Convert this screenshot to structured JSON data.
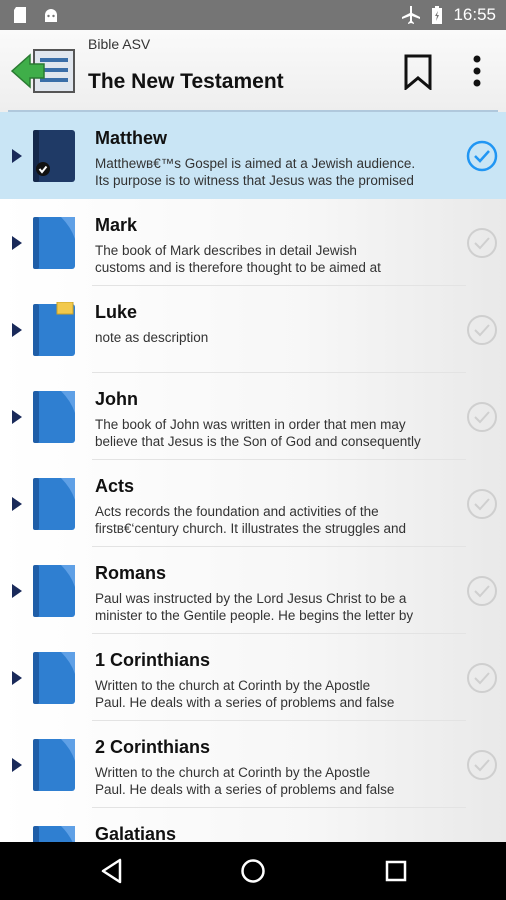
{
  "status": {
    "time": "16:55"
  },
  "header": {
    "subtitle": "Bible ASV",
    "title": "The New Testament"
  },
  "icons": {
    "back": "back-arrow-list-icon",
    "bookmark": "bookmark-icon",
    "menu": "more-vert-icon",
    "book": "book-icon",
    "check": "check-circle-icon"
  },
  "colors": {
    "selected_row": "#c9e5f5",
    "accent": "#2196f3",
    "book_blue": "#2f7fd1",
    "book_dark": "#1f3a66"
  },
  "books": [
    {
      "name": "Matthew",
      "line1": "Matthewв€™s Gospel is aimed at a Jewish audience.",
      "line2": "Its purpose is to witness that Jesus was the promised"
    },
    {
      "name": "Mark",
      "line1": "The book of Mark describes in detail Jewish",
      "line2": "customs and is therefore thought to be aimed at"
    },
    {
      "name": "Luke",
      "line1": "note as description",
      "line2": ""
    },
    {
      "name": "John",
      "line1": "The book of John was written in order that men may",
      "line2": "believe that Jesus is the Son of God and consequently"
    },
    {
      "name": "Acts",
      "line1": "Acts records the foundation and activities of the",
      "line2": "firstв€‘century church. It illustrates the struggles and"
    },
    {
      "name": "Romans",
      "line1": "Paul was instructed by the Lord Jesus Christ to be a",
      "line2": "minister to the Gentile people. He begins the letter by"
    },
    {
      "name": "1 Corinthians",
      "line1": "Written to the church at Corinth by the Apostle",
      "line2": "Paul. He deals with a series of problems and false"
    },
    {
      "name": "2 Corinthians",
      "line1": "Written to the church at Corinth by the Apostle",
      "line2": "Paul. He deals with a series of problems and false"
    },
    {
      "name": "Galatians",
      "line1": "",
      "line2": ""
    }
  ]
}
